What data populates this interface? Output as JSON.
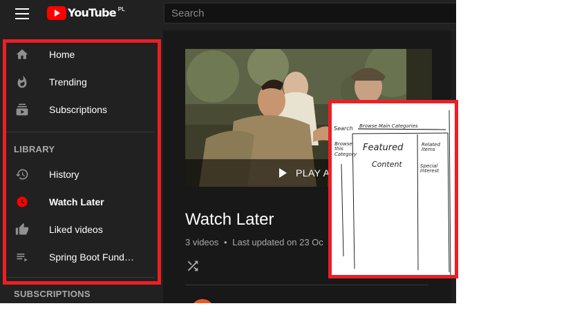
{
  "topbar": {
    "logo_text": "YouTube",
    "logo_region": "PL",
    "search_placeholder": "Search"
  },
  "sidebar": {
    "items": [
      {
        "label": "Home",
        "icon": "home-icon"
      },
      {
        "label": "Trending",
        "icon": "flame-icon"
      },
      {
        "label": "Subscriptions",
        "icon": "subscriptions-icon"
      }
    ],
    "library_title": "LIBRARY",
    "library_items": [
      {
        "label": "History",
        "icon": "history-icon"
      },
      {
        "label": "Watch Later",
        "icon": "clock-icon",
        "active": true
      },
      {
        "label": "Liked videos",
        "icon": "thumbs-up-icon"
      },
      {
        "label": "Spring Boot Fund…",
        "icon": "playlist-icon"
      }
    ],
    "subscriptions_title": "SUBSCRIPTIONS"
  },
  "playlist": {
    "play_all_label": "PLAY A",
    "title": "Watch Later",
    "video_count": "3 videos",
    "separator": "•",
    "updated": "Last updated on 23 Oc"
  },
  "wireframe": {
    "search": "Search",
    "browse_main": "Browse Main Categories",
    "browse_this_category": "Browse this Category",
    "featured": "Featured",
    "content": "Content",
    "related_items": "Related Items",
    "special_interest": "Special Interest"
  },
  "colors": {
    "highlight": "#ee1e24",
    "brand_red": "#ff0000",
    "sidebar_bg": "#212121",
    "page_bg": "#181818"
  }
}
